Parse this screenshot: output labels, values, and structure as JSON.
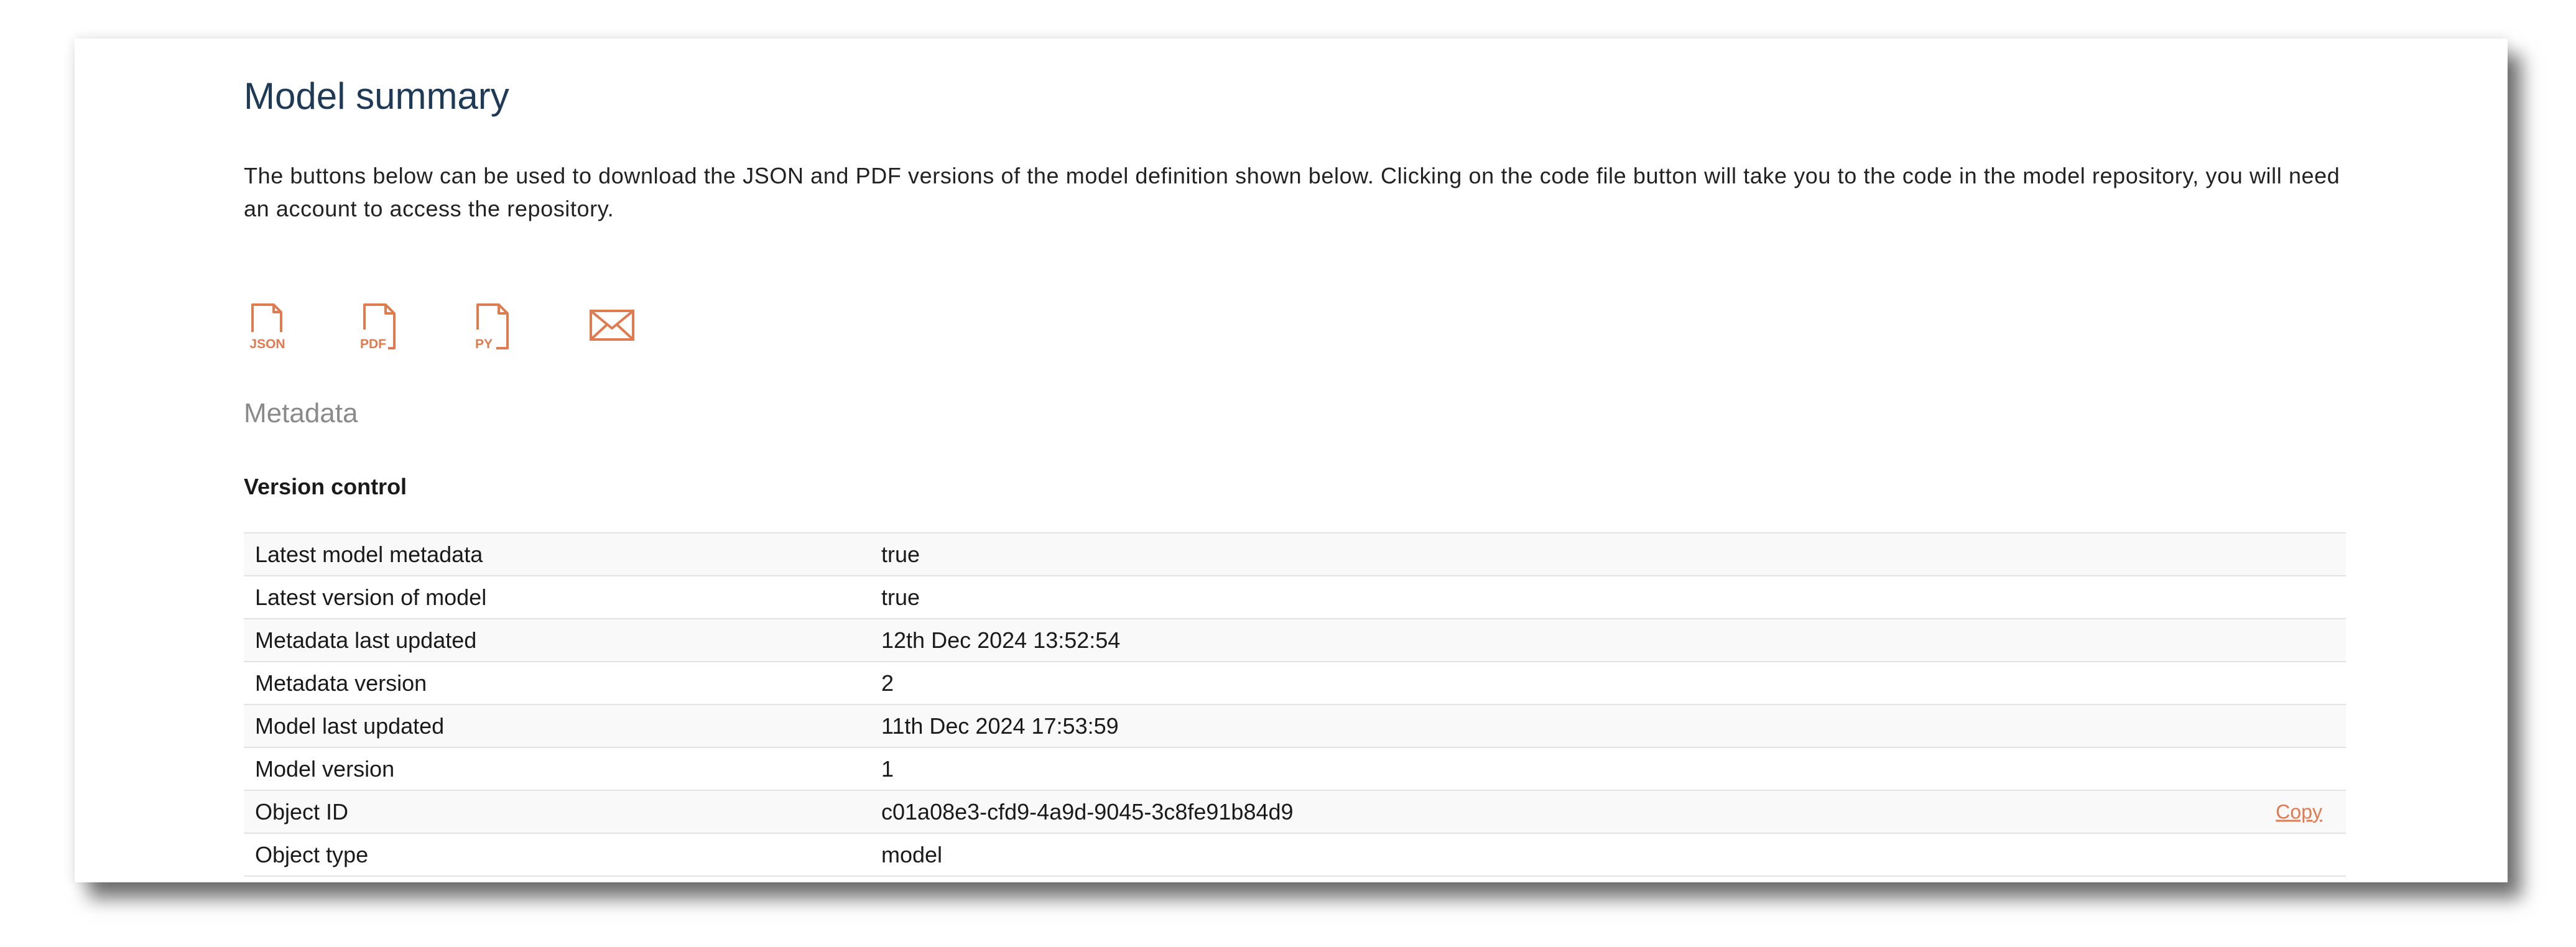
{
  "page": {
    "title": "Model summary",
    "intro": "The buttons below can be used to download the JSON and PDF versions of the model definition shown below. Clicking on the code file button will take you to the code in the model repository, you will need an account to access the repository."
  },
  "downloads": {
    "json_label": "JSON",
    "pdf_label": "PDF",
    "py_label": "PY",
    "email_icon": "envelope-icon",
    "accent_color": "#e07a4f"
  },
  "metadata": {
    "heading": "Metadata",
    "version_control": {
      "heading": "Version control",
      "rows": [
        {
          "label": "Latest model metadata",
          "value": "true"
        },
        {
          "label": "Latest version of model",
          "value": "true"
        },
        {
          "label": "Metadata last updated",
          "value": "12th Dec 2024 13:52:54"
        },
        {
          "label": "Metadata version",
          "value": "2"
        },
        {
          "label": "Model last updated",
          "value": "11th Dec 2024 17:53:59"
        },
        {
          "label": "Model version",
          "value": "1"
        },
        {
          "label": "Object ID",
          "value": "c01a08e3-cfd9-4a9d-9045-3c8fe91b84d9",
          "action": "Copy"
        },
        {
          "label": "Object type",
          "value": "model"
        }
      ]
    }
  }
}
